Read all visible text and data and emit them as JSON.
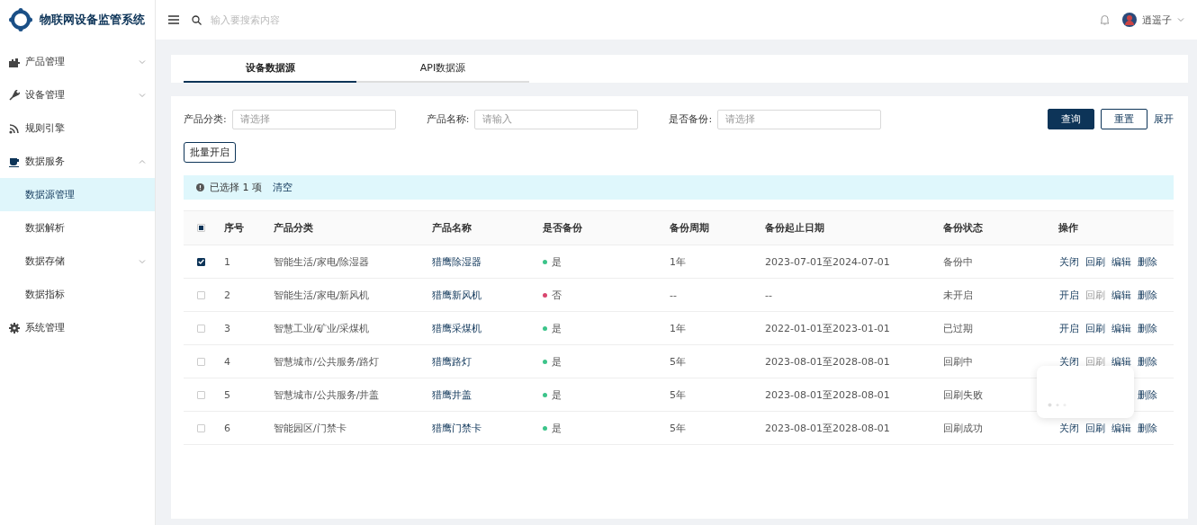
{
  "app": {
    "title": "物联网设备监管系统"
  },
  "sidebar": {
    "items": [
      {
        "label": "产品管理",
        "expanded": false,
        "selected": false
      },
      {
        "label": "设备管理",
        "expanded": false,
        "selected": false
      },
      {
        "label": "规则引擎",
        "selected": false
      },
      {
        "label": "数据服务",
        "expanded": true,
        "selected": false,
        "children": [
          {
            "label": "数据源管理",
            "selected": true
          },
          {
            "label": "数据解析",
            "selected": false
          },
          {
            "label": "数据存储",
            "selected": false,
            "expanded": false
          },
          {
            "label": "数据指标",
            "selected": false
          }
        ]
      },
      {
        "label": "系统管理",
        "selected": false
      }
    ]
  },
  "header": {
    "search": {
      "placeholder": "输入要搜索内容"
    },
    "user": {
      "name": "逍遥子"
    }
  },
  "tabs": [
    {
      "label": "设备数据源",
      "selected": true
    },
    {
      "label": "API数据源",
      "selected": false
    }
  ],
  "filters": [
    {
      "label": "产品分类:",
      "placeholder": "请选择"
    },
    {
      "label": "产品名称:",
      "placeholder": "请输入"
    },
    {
      "label": "是否备份:",
      "placeholder": "请选择"
    }
  ],
  "buttons": {
    "query": "查询",
    "reset": "重置",
    "expand": "展开",
    "batch": "批量开启"
  },
  "selection_bar": {
    "text": "已选择 1 项",
    "clear": "清空"
  },
  "table": {
    "header_checkbox": {
      "indeterminate": true
    },
    "columns": [
      "序号",
      "产品分类",
      "产品名称",
      "是否备份",
      "备份周期",
      "备份起止日期",
      "备份状态",
      "操作"
    ],
    "rows": [
      {
        "checked": true,
        "index": "1",
        "category": "智能生活/家电/除湿器",
        "name": "猎鹰除湿器",
        "backup": {
          "text": "是",
          "color": "#3cc48a"
        },
        "period": "1年",
        "dates": "2023-07-01至2024-07-01",
        "status": "备份中",
        "actions": [
          {
            "label": "关闭",
            "disabled": false
          },
          {
            "label": "回刷",
            "disabled": false
          },
          {
            "label": "编辑",
            "disabled": false
          },
          {
            "label": "删除",
            "disabled": false
          }
        ]
      },
      {
        "checked": false,
        "index": "2",
        "category": "智能生活/家电/新风机",
        "name": "猎鹰新风机",
        "backup": {
          "text": "否",
          "color": "#d9466f"
        },
        "period": "--",
        "dates": "--",
        "status": "未开启",
        "actions": [
          {
            "label": "开启",
            "disabled": false
          },
          {
            "label": "回刷",
            "disabled": true
          },
          {
            "label": "编辑",
            "disabled": false
          },
          {
            "label": "删除",
            "disabled": false
          }
        ]
      },
      {
        "checked": false,
        "index": "3",
        "category": "智慧工业/矿业/采煤机",
        "name": "猎鹰采煤机",
        "backup": {
          "text": "是",
          "color": "#3cc48a"
        },
        "period": "1年",
        "dates": "2022-01-01至2023-01-01",
        "status": "已过期",
        "actions": [
          {
            "label": "开启",
            "disabled": false
          },
          {
            "label": "回刷",
            "disabled": false
          },
          {
            "label": "编辑",
            "disabled": false
          },
          {
            "label": "删除",
            "disabled": false
          }
        ]
      },
      {
        "checked": false,
        "index": "4",
        "category": "智慧城市/公共服务/路灯",
        "name": "猎鹰路灯",
        "backup": {
          "text": "是",
          "color": "#3cc48a"
        },
        "period": "5年",
        "dates": "2023-08-01至2028-08-01",
        "status": "回刷中",
        "actions": [
          {
            "label": "关闭",
            "disabled": false
          },
          {
            "label": "回刷",
            "disabled": true
          },
          {
            "label": "编辑",
            "disabled": false
          },
          {
            "label": "删除",
            "disabled": false
          }
        ]
      },
      {
        "checked": false,
        "index": "5",
        "category": "智慧城市/公共服务/井盖",
        "name": "猎鹰井盖",
        "backup": {
          "text": "是",
          "color": "#3cc48a"
        },
        "period": "5年",
        "dates": "2023-08-01至2028-08-01",
        "status": "回刷失败",
        "actions": [
          {
            "label": "删除",
            "disabled": false
          }
        ]
      },
      {
        "checked": false,
        "index": "6",
        "category": "智能园区/门禁卡",
        "name": "猎鹰门禁卡",
        "backup": {
          "text": "是",
          "color": "#3cc48a"
        },
        "period": "5年",
        "dates": "2023-08-01至2028-08-01",
        "status": "回刷成功",
        "actions": [
          {
            "label": "关闭",
            "disabled": false
          },
          {
            "label": "回刷",
            "disabled": false
          },
          {
            "label": "编辑",
            "disabled": false
          },
          {
            "label": "删除",
            "disabled": false
          }
        ]
      }
    ]
  }
}
